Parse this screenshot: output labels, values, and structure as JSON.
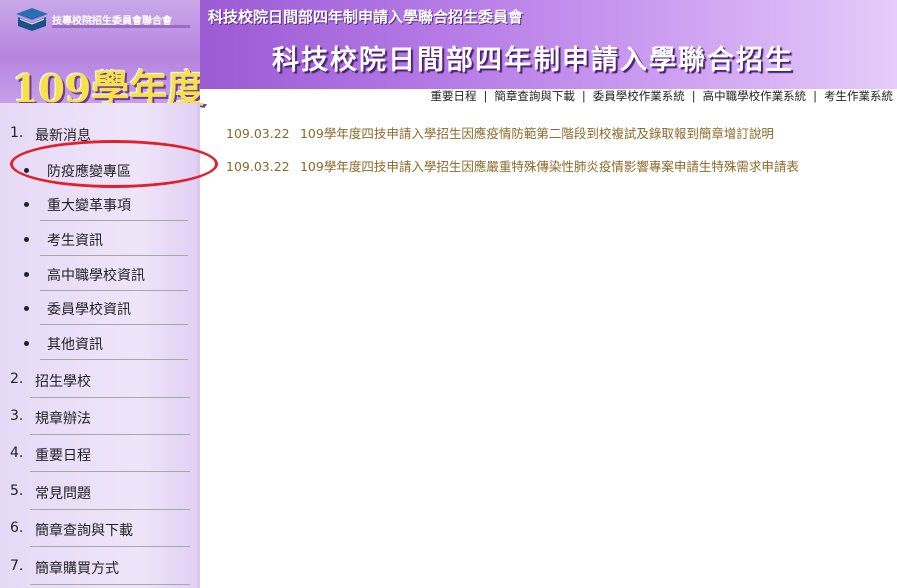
{
  "header": {
    "logo_text": "技專校院招生委員會聯合會",
    "year": "109學年度",
    "committee": "科技校院日間部四年制申請入學聯合招生委員會",
    "title": "科技校院日間部四年制申請入學聯合招生"
  },
  "topnav": {
    "items": [
      "重要日程",
      "簡章查詢與下載",
      "委員學校作業系統",
      "高中職學校作業系統",
      "考生作業系統"
    ],
    "separator": "|"
  },
  "sidebar": {
    "items": [
      {
        "num": "1.",
        "label": "最新消息"
      },
      {
        "num": "2.",
        "label": "招生學校"
      },
      {
        "num": "3.",
        "label": "規章辦法"
      },
      {
        "num": "4.",
        "label": "重要日程"
      },
      {
        "num": "5.",
        "label": "常見問題"
      },
      {
        "num": "6.",
        "label": "簡章查詢與下載"
      },
      {
        "num": "7.",
        "label": "簡章購買方式"
      }
    ],
    "subitems": [
      "防疫應變專區",
      "重大變革事項",
      "考生資訊",
      "高中職學校資訊",
      "委員學校資訊",
      "其他資訊"
    ]
  },
  "news": [
    {
      "date": "109.03.22",
      "title": "109學年度四技申請入學招生因應疫情防範第二階段到校複試及錄取報到簡章增訂說明"
    },
    {
      "date": "109.03.22",
      "title": "109學年度四技申請入學招生因應嚴重特殊傳染性肺炎疫情影響專案申請生特殊需求申請表"
    }
  ],
  "colors": {
    "highlight": "#e0202a",
    "news_text": "#8a6a2a",
    "year": "#f6e04c"
  }
}
